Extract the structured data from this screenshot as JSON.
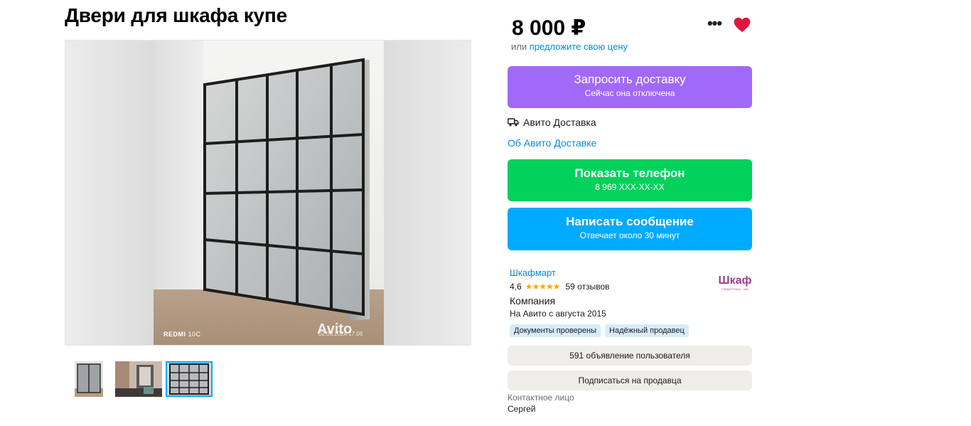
{
  "listing": {
    "title": "Двери для шкафа купе",
    "price": "8 000 ₽",
    "offer_prefix": "или",
    "offer_link": "предложите свою цену"
  },
  "gallery": {
    "watermark": "Avito",
    "camera_brand": "REDMI",
    "camera_model": "10C",
    "photo_timestamp": "02.08.2024 17:06"
  },
  "actions": {
    "more_icon": "more-dots-icon",
    "favorite_icon": "heart-icon",
    "favorite_color": "#e0143c"
  },
  "delivery": {
    "button_label": "Запросить доставку",
    "button_sub": "Сейчас она отключена",
    "button_color": "#a169f7",
    "service_label": "Авито Доставка",
    "service_icon": "truck-icon",
    "about_link": "Об Авито Доставке"
  },
  "phone": {
    "label": "Показать телефон",
    "number": "8 969 XXX-XX-XX",
    "color": "#02d15c"
  },
  "message": {
    "label": "Написать сообщение",
    "sub": "Отвечает около 30 минут",
    "color": "#00aaff"
  },
  "seller": {
    "name": "Шкафмарт",
    "rating": "4,6",
    "stars": "★★★★★",
    "reviews": "59 отзывов",
    "type": "Компания",
    "since": "На Авито с августа 2015",
    "logo_word": "Шкаф",
    "logo_sub": "ГАРДЕРОБЫ · ШК",
    "badges": [
      "Документы проверены",
      "Надёжный продавец"
    ],
    "listings_button": "591 объявление пользователя",
    "subscribe_button": "Подписаться на продавца"
  },
  "contact": {
    "label": "Контактное лицо",
    "name": "Сергей"
  }
}
